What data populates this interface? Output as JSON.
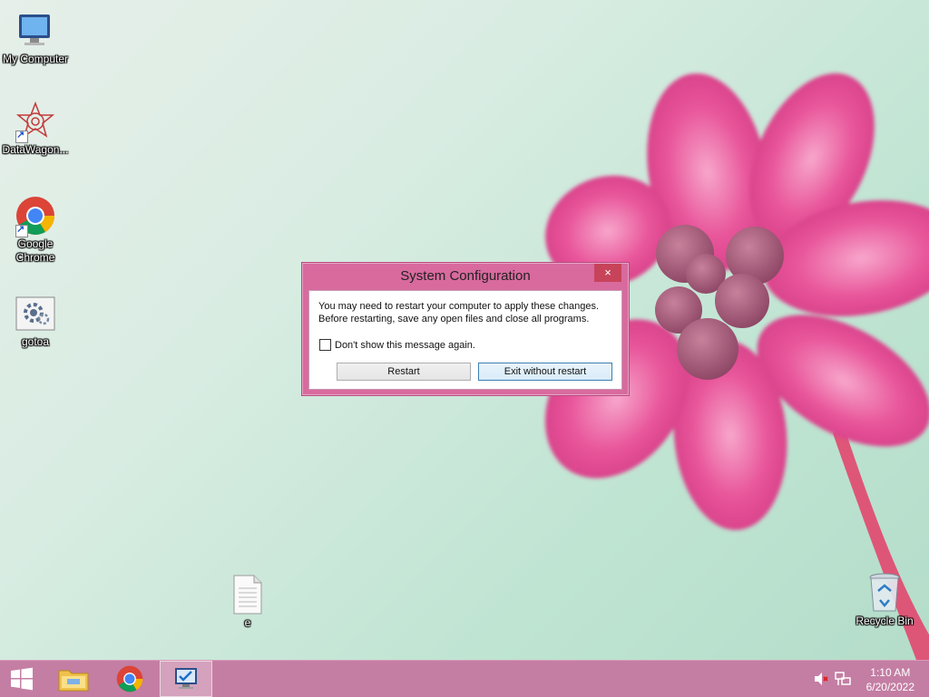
{
  "desktop": {
    "icons": [
      {
        "label": "My Computer"
      },
      {
        "label": "DataWagon..."
      },
      {
        "label": "Google Chrome"
      },
      {
        "label": "gotoa"
      },
      {
        "label": "e"
      },
      {
        "label": "Recycle Bin"
      }
    ]
  },
  "dialog": {
    "title": "System Configuration",
    "close_label": "×",
    "message_line1": "You may need to restart your computer to apply these changes.",
    "message_line2": "Before restarting, save any open files and close all programs.",
    "checkbox_label": "Don't show this message again.",
    "restart_label": "Restart",
    "exit_label": "Exit without restart"
  },
  "taskbar": {
    "time": "1:10 AM",
    "date": "6/20/2022"
  },
  "colors": {
    "taskbar": "#c47ea3",
    "dialog_frame": "#d86a9e",
    "close_button": "#c7435a"
  }
}
